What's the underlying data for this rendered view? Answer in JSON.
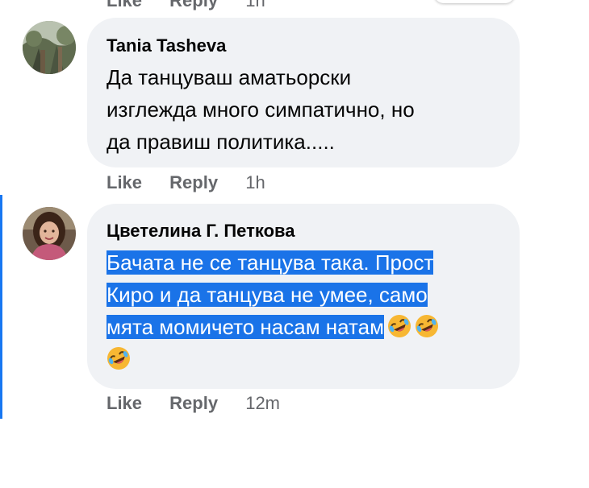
{
  "top_partial": {
    "like": "Like",
    "reply": "Reply",
    "time": "1h"
  },
  "comments": [
    {
      "author": "Tania Tasheva",
      "lines": [
        "Да танцуваш аматьорски",
        "изглежда много симпатично, но",
        "да правиш политика....."
      ],
      "actions": {
        "like": "Like",
        "reply": "Reply",
        "time": "1h"
      }
    },
    {
      "author": "Цветелина Г. Петкова",
      "lines": [
        "Бачата не се танцува така. Прост",
        "Киро и да танцува не умее, само",
        "мята момичето насам натам"
      ],
      "emoji": "rolling-on-floor-laughing",
      "actions": {
        "like": "Like",
        "reply": "Reply",
        "time": "12m"
      }
    }
  ],
  "colors": {
    "bubble": "#f0f2f5",
    "selection": "#1a73e8",
    "secondary_text": "#65676b",
    "focus_bar": "#1877f2"
  }
}
